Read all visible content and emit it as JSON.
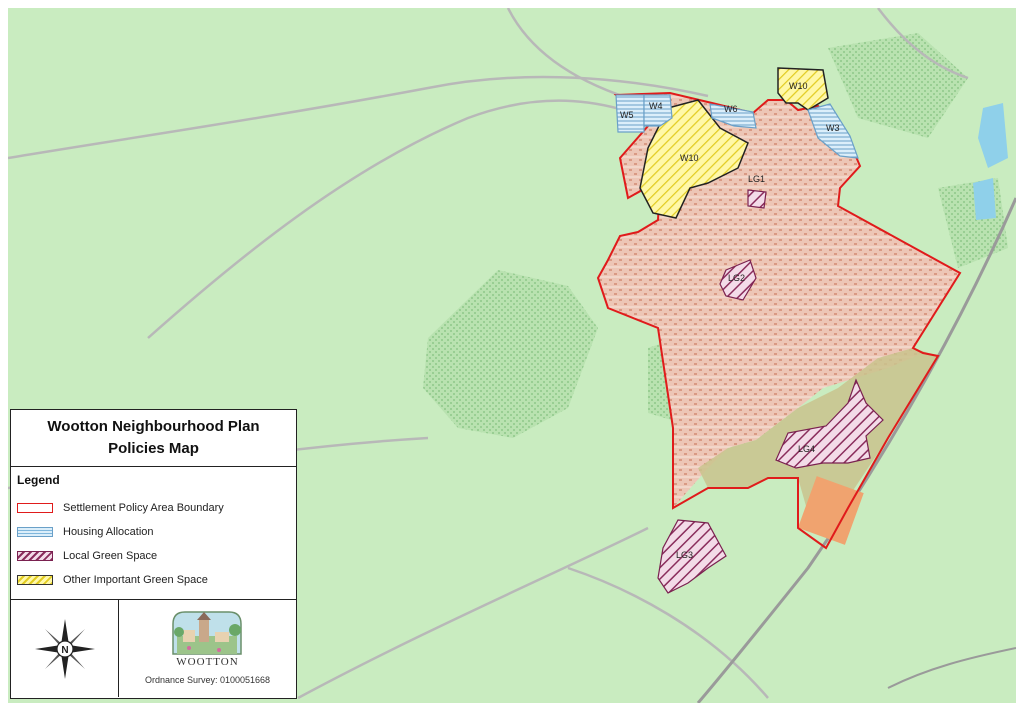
{
  "panel": {
    "title_line1": "Wootton Neighbourhood Plan",
    "title_line2": "Policies Map"
  },
  "legend": {
    "heading": "Legend",
    "items": [
      {
        "label": "Settlement Policy Area Boundary",
        "swatch": "red-outline"
      },
      {
        "label": "Housing Allocation",
        "swatch": "blue-hatch"
      },
      {
        "label": "Local Green Space",
        "swatch": "purple-hatch"
      },
      {
        "label": "Other Important Green Space",
        "swatch": "yellow-hatch"
      }
    ]
  },
  "compass": {
    "letter": "N",
    "icon": "compass-rose-icon"
  },
  "logo": {
    "text": "WOOTTON",
    "icon": "village-crest-icon"
  },
  "copyright": "Ordnance Survey: 0100051668",
  "map": {
    "labels": {
      "W10_north": "W10",
      "W10_main": "W10",
      "W4": "W4",
      "W5": "W5",
      "W6": "W6",
      "W3": "W3",
      "LG1": "LG1",
      "LG2": "LG2",
      "LG3": "LG3",
      "LG4": "LG4"
    }
  },
  "colors": {
    "background": "#c9ecc0",
    "settlement_boundary": "#e01b1b",
    "housing_allocation": "#7fb6dc",
    "local_green_space": "#8a2d5c",
    "other_green_space": "#e2cc22",
    "urban_fill": "#eac3b3"
  }
}
